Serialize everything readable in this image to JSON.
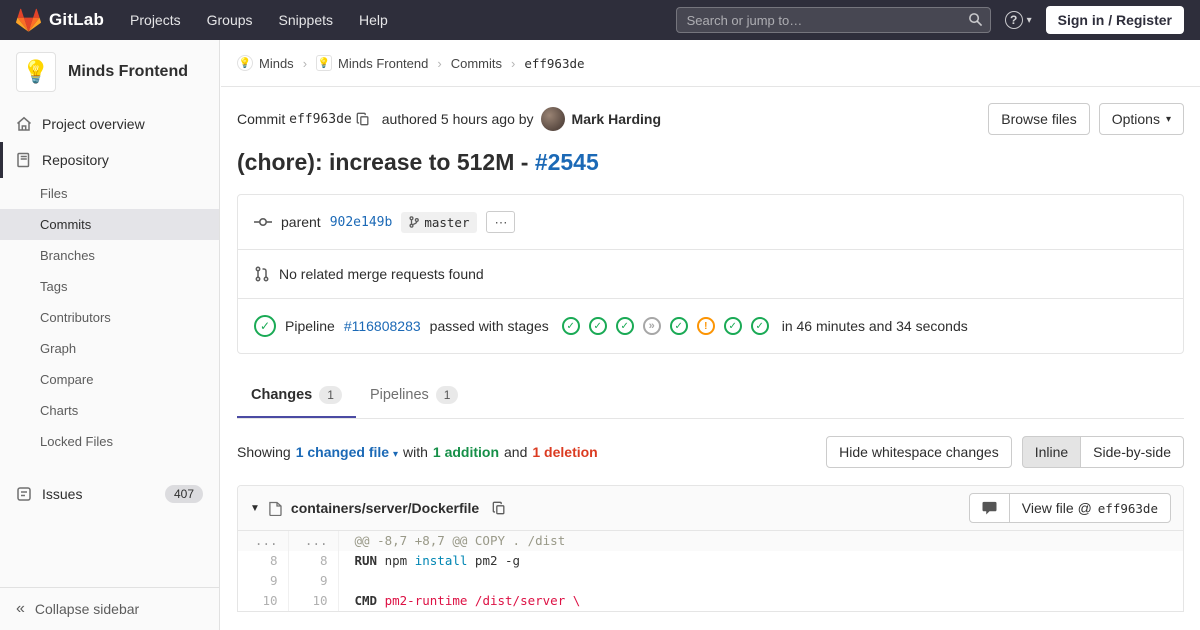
{
  "colors": {
    "brand_orange": "#e24329",
    "brand_mid_orange": "#fc6d26",
    "brand_light_orange": "#fca326",
    "navbar_bg": "#2e2e3b",
    "link_blue": "#1b69b6",
    "success_green": "#1aaa55",
    "warning_orange": "#fc9403",
    "addition_green": "#168f48",
    "deletion_red": "#db3b21",
    "active_tab_indigo": "#4b4ba3"
  },
  "icons": {
    "dropdown_caret": "▾",
    "breadcrumb_separator": "›",
    "ellipsis": "⋯",
    "collapse": "«",
    "question_mark": "?",
    "stage_success": "✓",
    "stage_skipped": "»",
    "stage_warning": "!",
    "file_collapse_caret": "▼",
    "project_bulb": "💡"
  },
  "navbar": {
    "logo_text": "GitLab",
    "menu": [
      "Projects",
      "Groups",
      "Snippets",
      "Help"
    ],
    "search_placeholder": "Search or jump to…",
    "sign_in": "Sign in / Register"
  },
  "sidebar": {
    "project_name": "Minds Frontend",
    "overview_label": "Project overview",
    "repository_label": "Repository",
    "repo_items": [
      "Files",
      "Commits",
      "Branches",
      "Tags",
      "Contributors",
      "Graph",
      "Compare",
      "Charts",
      "Locked Files"
    ],
    "issues_label": "Issues",
    "issues_count": "407",
    "collapse_label": "Collapse sidebar"
  },
  "breadcrumb": {
    "group": "Minds",
    "project": "Minds Frontend",
    "section": "Commits",
    "current": "eff963de"
  },
  "commit_header": {
    "commit_label": "Commit",
    "sha": "eff963de",
    "authored_text": "authored 5 hours ago by",
    "author": "Mark Harding",
    "browse_files": "Browse files",
    "options": "Options"
  },
  "title": {
    "text": "(chore): increase to 512M - ",
    "link": "#2545"
  },
  "commit_box": {
    "parent_label": "parent",
    "parent_sha": "902e149b",
    "branch": "master",
    "no_mr_text": "No related merge requests found",
    "pipeline": {
      "label": "Pipeline",
      "number": "#116808283",
      "status_text": "passed with stages",
      "stages": [
        "success",
        "success",
        "success",
        "skipped",
        "success",
        "warning",
        "success",
        "success"
      ],
      "duration": "in 46 minutes and 34 seconds"
    }
  },
  "tabs": [
    {
      "label": "Changes",
      "count": "1"
    },
    {
      "label": "Pipelines",
      "count": "1"
    }
  ],
  "diff_toolbar": {
    "showing": "Showing",
    "changed_file": "1 changed file",
    "with_word": "with",
    "additions": "1 addition",
    "and_word": "and",
    "deletions": "1 deletion",
    "hide_whitespace": "Hide whitespace changes",
    "inline": "Inline",
    "side_by_side": "Side-by-side"
  },
  "diff_file": {
    "path": "containers/server/Dockerfile",
    "view_file_label": "View file @",
    "view_file_sha": "eff963de",
    "lines": [
      {
        "type": "hunk",
        "old": "...",
        "new": "...",
        "segments": [
          {
            "text": "@@ -8,7 +8,7 @@ COPY . /dist",
            "color": "hunk"
          }
        ]
      },
      {
        "type": "context",
        "old": "8",
        "new": "8",
        "segments": [
          {
            "text": "RUN",
            "color": "keyword"
          },
          {
            "text": " npm ",
            "color": "plain"
          },
          {
            "text": "install",
            "color": "teal"
          },
          {
            "text": " pm2 -g",
            "color": "plain"
          }
        ]
      },
      {
        "type": "context",
        "old": "9",
        "new": "9",
        "segments": []
      },
      {
        "type": "context",
        "old": "10",
        "new": "10",
        "segments": [
          {
            "text": "CMD",
            "color": "keyword"
          },
          {
            "text": " ",
            "color": "plain"
          },
          {
            "text": "pm2-runtime /dist/server \\",
            "color": "red"
          }
        ]
      }
    ]
  }
}
